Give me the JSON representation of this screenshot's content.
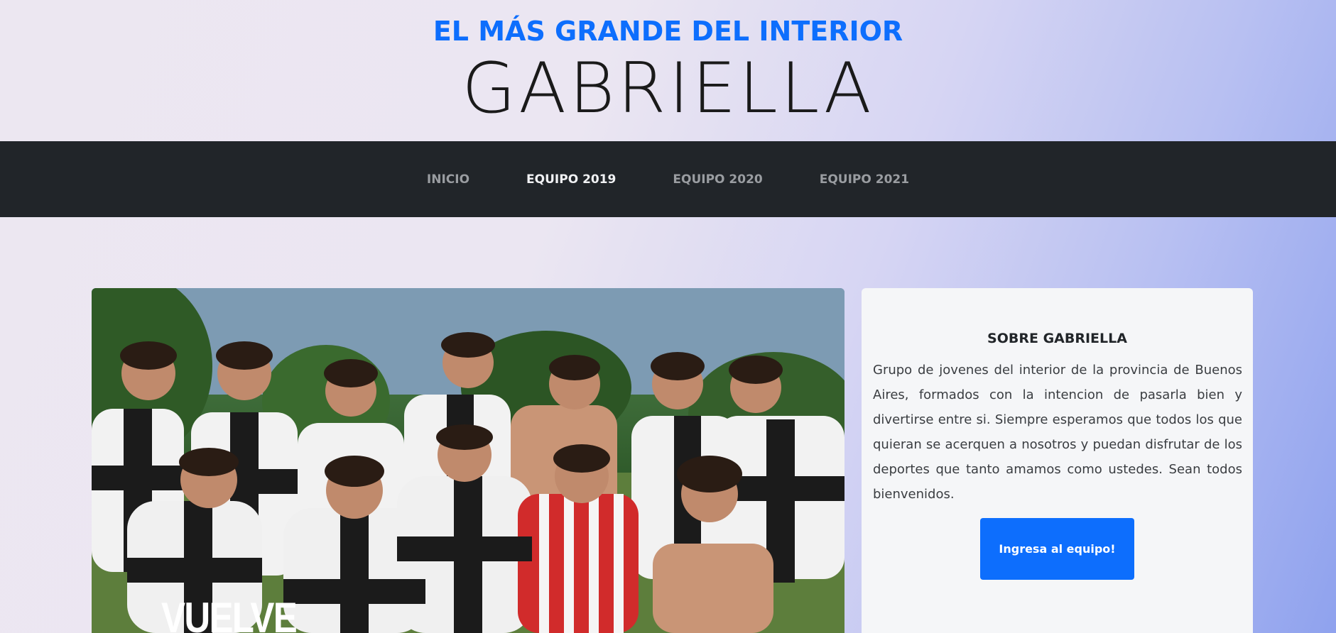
{
  "header": {
    "tagline": "EL MÁS GRANDE DEL INTERIOR",
    "title": "GABRIELLA"
  },
  "nav": {
    "items": [
      {
        "label": "INICIO"
      },
      {
        "label": "EQUIPO 2019"
      },
      {
        "label": "EQUIPO 2020"
      },
      {
        "label": "EQUIPO 2021"
      }
    ],
    "active": "EQUIPO 2019"
  },
  "hero": {
    "overlay_text": "VUELVE"
  },
  "about": {
    "title": "SOBRE GABRIELLA",
    "text": "Grupo de jovenes del interior de la provincia de Buenos Aires, formados con la intencion de pasarla bien y divertirse entre si. Siempre esperamos que todos los que quieran se acerquen a nosotros y puedan disfrutar de los deportes que tanto amamos como ustedes. Sean todos bienvenidos.",
    "button_label": "Ingresa al equipo!"
  },
  "colors": {
    "accent": "#0d6efd",
    "navbar": "#212529"
  }
}
